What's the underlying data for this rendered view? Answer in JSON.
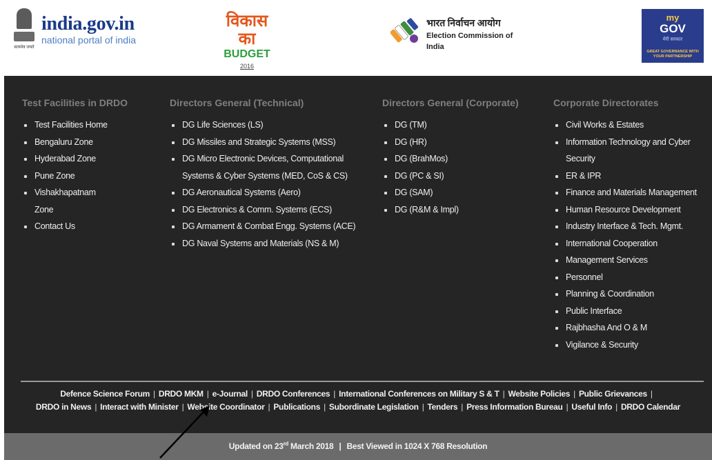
{
  "header": {
    "emblem_motto": "सत्यमेव जयते",
    "indiagov_title": "india.gov.in",
    "indiagov_sub": "national portal of india",
    "budget_title": "विकास का",
    "budget_word": "BUDGET",
    "budget_year": "2016",
    "eci_hindi": "भारत निर्वाचन आयोग",
    "eci_english": "Election Commission of India",
    "mygov_my": "my",
    "mygov_gov": "GOV",
    "mygov_hindi": "मेरी सरकार",
    "mygov_tagline": "GREAT GOVERNANCE WITH YOUR PARTNERSHIP"
  },
  "columns": {
    "test": {
      "heading": "Test Facilities in DRDO",
      "items": [
        "Test Facilities Home",
        "Bengaluru Zone",
        "Hyderabad Zone",
        "Pune Zone",
        "Vishakhapatnam",
        "Zone",
        "Contact Us"
      ]
    },
    "technical": {
      "heading": "Directors General (Technical)",
      "items": [
        "DG Life Sciences (LS)",
        "DG Missiles and Strategic Systems (MSS)",
        "DG Micro Electronic Devices, Computational",
        "Systems & Cyber Systems (MED, CoS & CS)",
        "DG Aeronautical Systems (Aero)",
        "DG Electronics & Comm. Systems (ECS)",
        "DG Armament & Combat Engg. Systems (ACE)",
        "DG Naval Systems and Materials (NS & M)"
      ]
    },
    "corporate": {
      "heading": "Directors General (Corporate)",
      "items": [
        "DG (TM)",
        "DG (HR)",
        "DG (BrahMos)",
        "DG (PC & SI)",
        "DG (SAM)",
        "DG (R&M & Impl)"
      ]
    },
    "directorates": {
      "heading": "Corporate Directorates",
      "items": [
        "Civil Works & Estates",
        "Information Technology and Cyber",
        "Security",
        "ER & IPR",
        "Finance and Materials Management",
        "Human Resource Development",
        "Industry Interface & Tech. Mgmt.",
        "International Cooperation",
        "Management Services",
        "Personnel",
        "Planning & Coordination",
        "Public Interface",
        "Rajbhasha And O & M",
        "Vigilance & Security"
      ]
    }
  },
  "footer_links": {
    "row1": [
      "Defence Science Forum",
      "DRDO MKM",
      "e-Journal",
      "DRDO Conferences",
      "International Conferences on Military S & T",
      "Website Policies",
      "Public Grievances"
    ],
    "row2": [
      "DRDO in News",
      "Interact with Minister",
      "Website Coordinator",
      "Publications",
      "Subordinate Legislation",
      "Tenders",
      "Press Information Bureau",
      "Useful Info",
      "DRDO Calendar"
    ],
    "separator": "|"
  },
  "updated": {
    "prefix": "Updated on 23",
    "suffix_sup": "rd",
    "date_rest": " March 2018",
    "separator": "|",
    "resolution": "Best Viewed in 1024 X 768 Resolution"
  },
  "colors": {
    "dark_bg": "#252525",
    "heading_gray": "#7f7f7f",
    "updated_bar": "#6b6b6b",
    "indiagov_blue": "#1a3a8a",
    "budget_orange": "#e4571c",
    "budget_green": "#2b9e3b",
    "mygov_blue": "#2a3c8c"
  }
}
